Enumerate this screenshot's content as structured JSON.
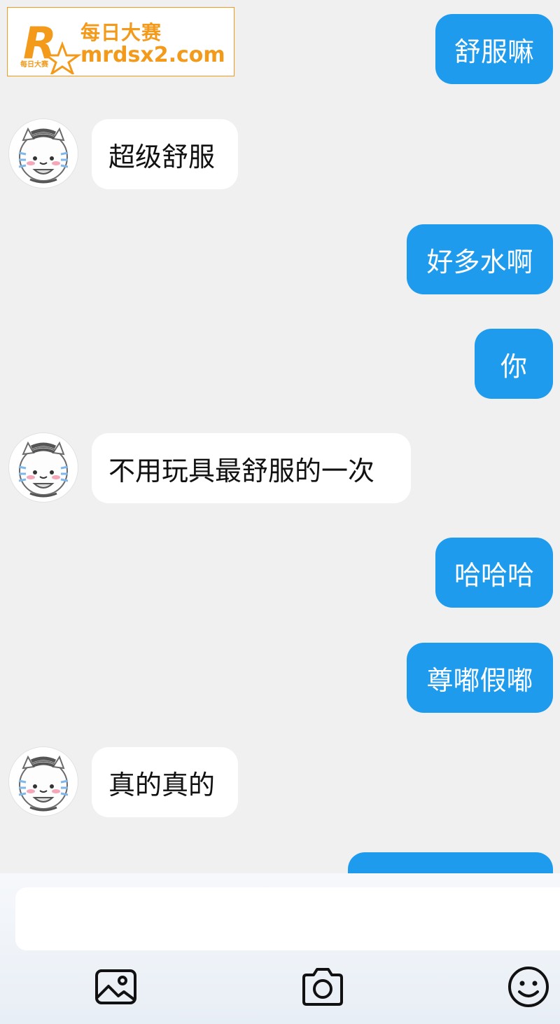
{
  "watermark": {
    "logo_letter": "R",
    "logo_small": "每日大赛",
    "line1": "每日大赛",
    "line2": "mrdsx2.com"
  },
  "messages": [
    {
      "side": "out",
      "text": "舒服嘛"
    },
    {
      "side": "in",
      "text": "超级舒服"
    },
    {
      "side": "out",
      "text": "好多水啊"
    },
    {
      "side": "out",
      "text": "你"
    },
    {
      "side": "in",
      "text": "不用玩具最舒服的一次"
    },
    {
      "side": "out",
      "text": "哈哈哈"
    },
    {
      "side": "out",
      "text": "尊嘟假嘟"
    },
    {
      "side": "in",
      "text": "真的真的"
    },
    {
      "side": "out",
      "text": ""
    }
  ],
  "composer": {
    "input_value": "",
    "icons": [
      "image-icon",
      "camera-icon",
      "emoji-icon"
    ]
  },
  "colors": {
    "background": "#f0f0f0",
    "outgoing_bubble": "#1f9bee",
    "incoming_bubble": "#ffffff",
    "watermark": "#f39a1b"
  }
}
